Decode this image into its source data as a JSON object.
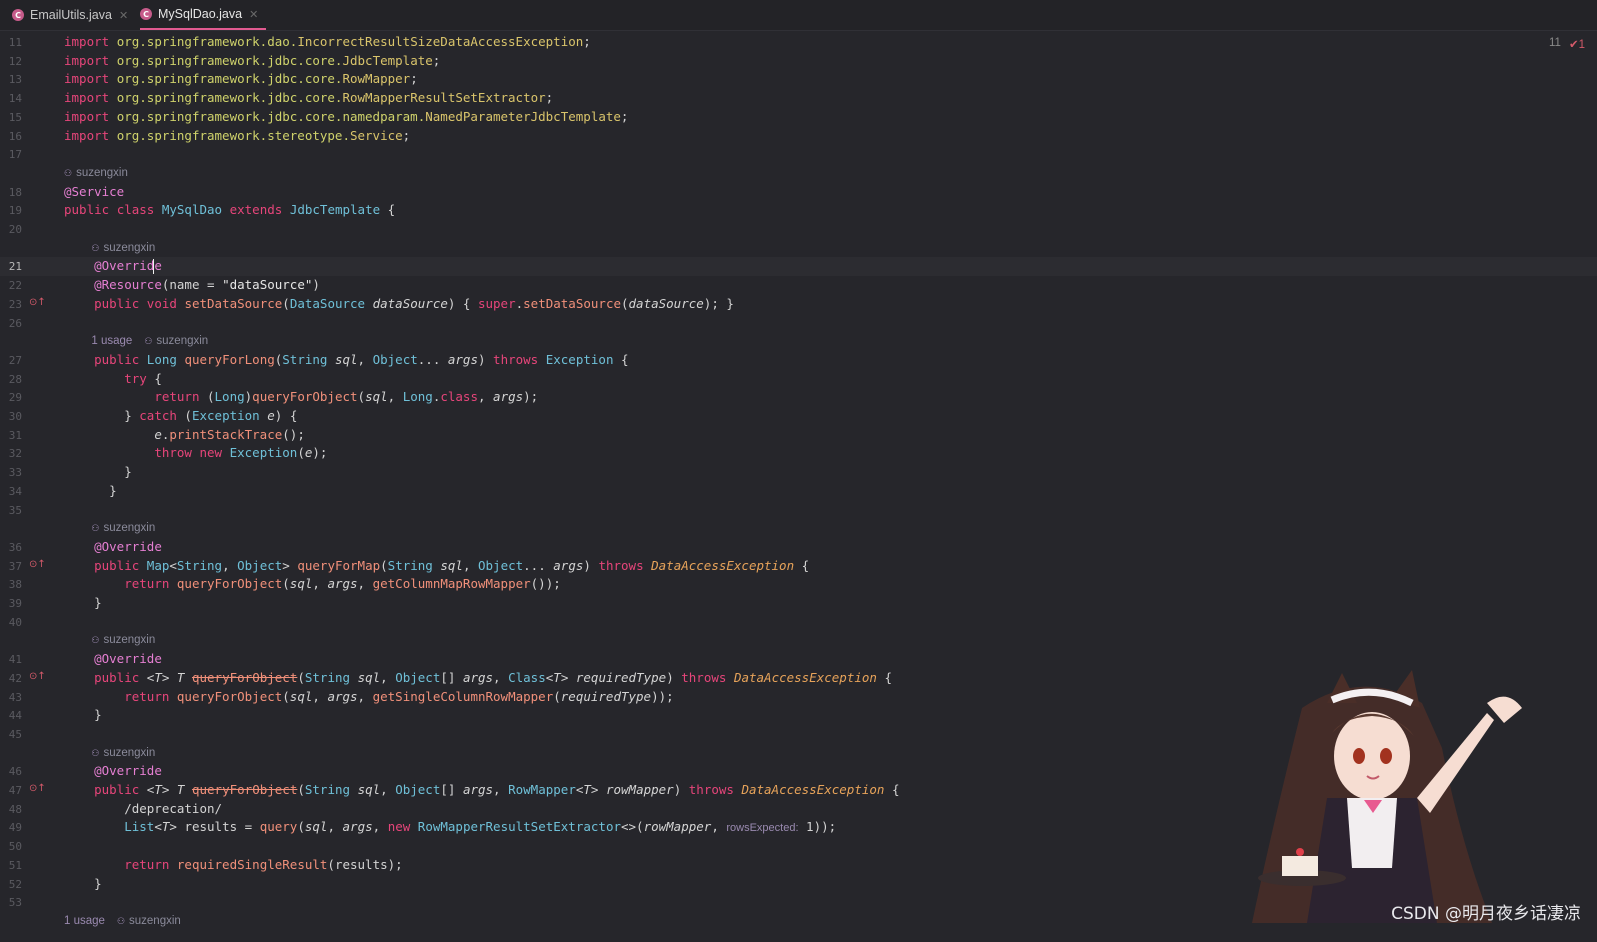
{
  "tabs": [
    {
      "label": "EmailUtils.java",
      "icon": "C",
      "active": false
    },
    {
      "label": "MySqlDao.java",
      "icon": "C",
      "active": true
    }
  ],
  "editor": {
    "inspection": {
      "count": "11",
      "check_count": "1"
    },
    "watermark": "CSDN @明月夜乡话凄凉",
    "lines": [
      {
        "n": "11",
        "code": "import org.springframework.dao.IncorrectResultSizeDataAccessException;"
      },
      {
        "n": "12",
        "code": "import org.springframework.jdbc.core.JdbcTemplate;"
      },
      {
        "n": "13",
        "code": "import org.springframework.jdbc.core.RowMapper;"
      },
      {
        "n": "14",
        "code": "import org.springframework.jdbc.core.RowMapperResultSetExtractor;"
      },
      {
        "n": "15",
        "code": "import org.springframework.jdbc.core.namedparam.NamedParameterJdbcTemplate;"
      },
      {
        "n": "16",
        "code": "import org.springframework.stereotype.Service;"
      },
      {
        "n": "17",
        "code": ""
      },
      {
        "hint": {
          "usage": "",
          "author": "suzengxin"
        }
      },
      {
        "n": "18",
        "code": "@Service"
      },
      {
        "n": "19",
        "code": "public class MySqlDao extends JdbcTemplate {"
      },
      {
        "n": "20",
        "code": ""
      },
      {
        "hint": {
          "usage": "",
          "author": "suzengxin"
        }
      },
      {
        "n": "21",
        "code": "    @Override",
        "current": true
      },
      {
        "n": "22",
        "code": "    @Resource(name = \"dataSource\")"
      },
      {
        "n": "23",
        "code": "    public void setDataSource(DataSource dataSource) { super.setDataSource(dataSource); }",
        "gutter": "override"
      },
      {
        "n": "26",
        "code": ""
      },
      {
        "hint": {
          "usage": "1 usage",
          "author": "suzengxin"
        }
      },
      {
        "n": "27",
        "code": "    public Long queryForLong(String sql, Object... args) throws Exception {"
      },
      {
        "n": "28",
        "code": "        try {"
      },
      {
        "n": "29",
        "code": "            return (Long)queryForObject(sql, Long.class, args);"
      },
      {
        "n": "30",
        "code": "        } catch (Exception e) {"
      },
      {
        "n": "31",
        "code": "            e.printStackTrace();"
      },
      {
        "n": "32",
        "code": "            throw new Exception(e);"
      },
      {
        "n": "33",
        "code": "        }"
      },
      {
        "n": "34",
        "code": "      }"
      },
      {
        "n": "35",
        "code": ""
      },
      {
        "hint": {
          "usage": "",
          "author": "suzengxin"
        }
      },
      {
        "n": "36",
        "code": "    @Override"
      },
      {
        "n": "37",
        "code": "    public Map<String, Object> queryForMap(String sql, Object... args) throws DataAccessException {",
        "gutter": "override"
      },
      {
        "n": "38",
        "code": "        return queryForObject(sql, args, getColumnMapRowMapper());"
      },
      {
        "n": "39",
        "code": "    }"
      },
      {
        "n": "40",
        "code": ""
      },
      {
        "hint": {
          "usage": "",
          "author": "suzengxin"
        }
      },
      {
        "n": "41",
        "code": "    @Override"
      },
      {
        "n": "42",
        "code": "    public <T> T queryForObject(String sql, Object[] args, Class<T> requiredType) throws DataAccessException {",
        "gutter": "override"
      },
      {
        "n": "43",
        "code": "        return queryForObject(sql, args, getSingleColumnRowMapper(requiredType));"
      },
      {
        "n": "44",
        "code": "    }"
      },
      {
        "n": "45",
        "code": ""
      },
      {
        "hint": {
          "usage": "",
          "author": "suzengxin"
        }
      },
      {
        "n": "46",
        "code": "    @Override"
      },
      {
        "n": "47",
        "code": "    public <T> T queryForObject(String sql, Object[] args, RowMapper<T> rowMapper) throws DataAccessException {",
        "gutter": "override"
      },
      {
        "n": "48",
        "code": "        /deprecation/"
      },
      {
        "n": "49",
        "code": "        List<T> results = query(sql, args, new RowMapperResultSetExtractor<>(rowMapper, rowsExpected: 1));"
      },
      {
        "n": "50",
        "code": ""
      },
      {
        "n": "51",
        "code": "        return requiredSingleResult(results);"
      },
      {
        "n": "52",
        "code": "    }"
      },
      {
        "n": "53",
        "code": ""
      },
      {
        "hint": {
          "usage": "1 usage",
          "author": "suzengxin"
        }
      }
    ]
  }
}
